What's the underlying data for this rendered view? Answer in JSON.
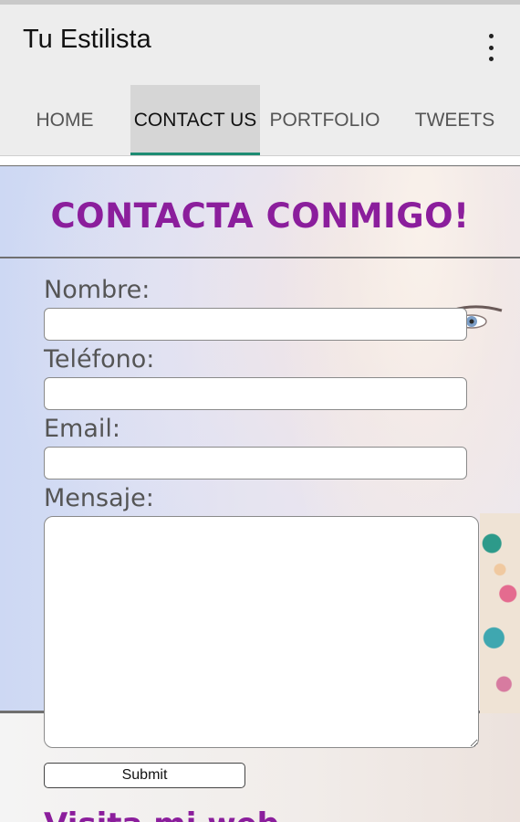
{
  "app": {
    "title": "Tu Estilista"
  },
  "tabs": [
    {
      "label": "HOME",
      "active": false
    },
    {
      "label": "CONTACT US",
      "active": true
    },
    {
      "label": "PORTFOLIO",
      "active": false
    },
    {
      "label": "TWEETS",
      "active": false
    }
  ],
  "contact": {
    "heading": "CONTACTA CONMIGO!",
    "fields": {
      "name_label": "Nombre:",
      "name_value": "",
      "phone_label": "Teléfono:",
      "phone_value": "",
      "email_label": "Email:",
      "email_value": "",
      "message_label": "Mensaje:",
      "message_value": ""
    },
    "submit_label": "Submit"
  },
  "footer": {
    "heading_partial": "Visita mi web"
  },
  "icons": {
    "overflow": "more-vert-icon"
  },
  "colors": {
    "heading": "#8b1e9c",
    "tab_indicator": "#1e8c73",
    "appbar_bg": "#ededed"
  }
}
